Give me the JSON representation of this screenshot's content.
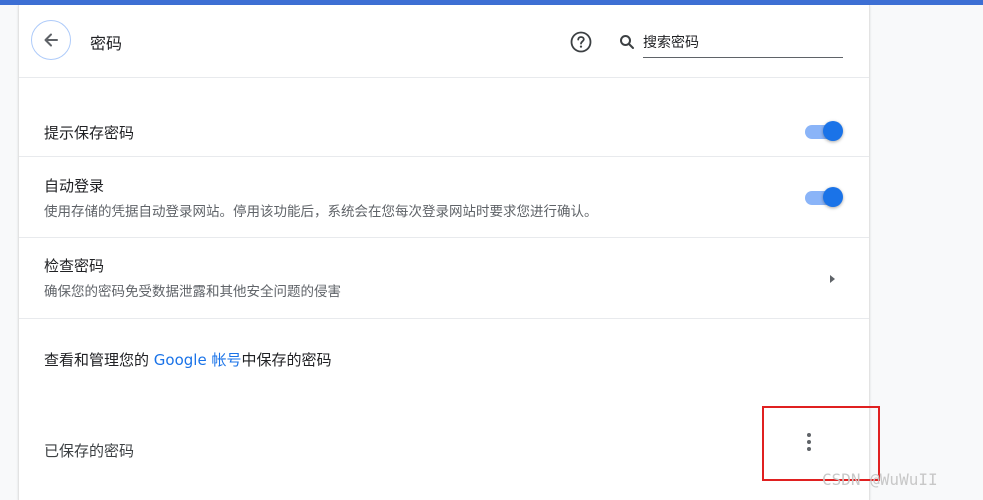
{
  "header": {
    "title": "密码",
    "help_icon": "help-circle-icon",
    "search_placeholder": "搜索密码"
  },
  "settings": {
    "offer_to_save": {
      "title": "提示保存密码",
      "enabled": true
    },
    "auto_signin": {
      "title": "自动登录",
      "description": "使用存储的凭据自动登录网站。停用该功能后，系统会在您每次登录网站时要求您进行确认。",
      "enabled": true
    },
    "check_passwords": {
      "title": "检查密码",
      "description": "确保您的密码免受数据泄露和其他安全问题的侵害"
    },
    "manage_account": {
      "prefix": "查看和管理您的 ",
      "link_text": "Google 帐号",
      "suffix": "中保存的密码"
    }
  },
  "saved_passwords": {
    "heading": "已保存的密码"
  },
  "watermark": "CSDN @WuWuII",
  "colors": {
    "accent": "#1a73e8",
    "toggle_track": "#8ab4f8",
    "highlight": "#e02020",
    "top_bar": "#3d6fd4"
  }
}
